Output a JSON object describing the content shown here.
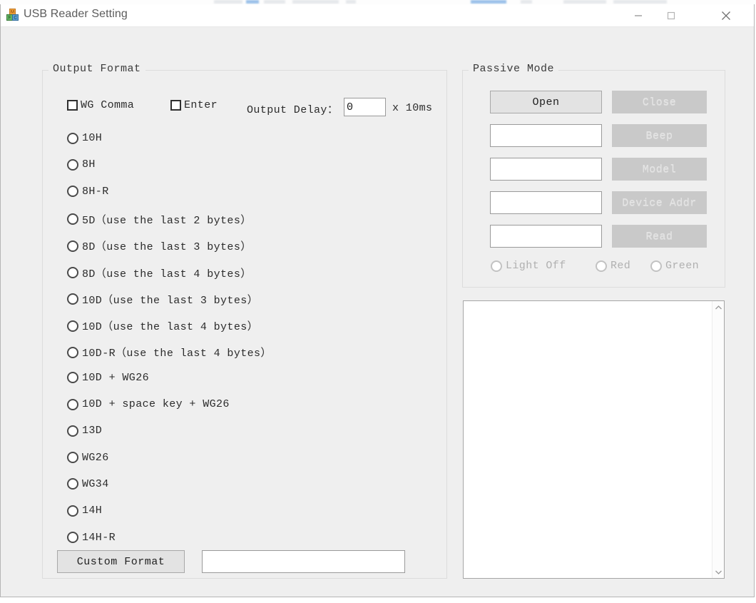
{
  "window": {
    "title": "USB Reader Setting",
    "icon": "toy-blocks-icon",
    "controls": {
      "minimize": "—",
      "maximize": "▢",
      "close": "✕"
    }
  },
  "output_format": {
    "legend": "Output Format",
    "checkboxes": [
      {
        "label": "WG Comma",
        "checked": false
      },
      {
        "label": "Enter",
        "checked": false
      }
    ],
    "delay": {
      "label": "Output Delay：",
      "value": "0",
      "placeholder": "",
      "unit": "x 10ms"
    },
    "radios": [
      {
        "label": "10H",
        "selected": false
      },
      {
        "label": "8H",
        "selected": false
      },
      {
        "label": "8H-R",
        "selected": false
      },
      {
        "label": "5D（use the last 2 bytes）",
        "selected": false
      },
      {
        "label": "8D（use the last 3 bytes）",
        "selected": false
      },
      {
        "label": "8D（use the last 4 bytes）",
        "selected": false
      },
      {
        "label": "10D（use the last 3 bytes）",
        "selected": false
      },
      {
        "label": "10D（use the last 4 bytes）",
        "selected": false
      },
      {
        "label": "10D-R（use the last 4 bytes）",
        "selected": false
      },
      {
        "label": "10D + WG26",
        "selected": false
      },
      {
        "label": "10D + space key + WG26",
        "selected": false
      },
      {
        "label": "13D",
        "selected": false
      },
      {
        "label": "WG26",
        "selected": false
      },
      {
        "label": "WG34",
        "selected": false
      },
      {
        "label": "14H",
        "selected": false
      },
      {
        "label": "14H-R",
        "selected": false
      }
    ],
    "custom": {
      "button_label": "Custom Format",
      "value": "",
      "placeholder": ""
    }
  },
  "passive_mode": {
    "legend": "Passive Mode",
    "buttons": [
      {
        "label": "Open",
        "enabled": true
      },
      {
        "label": "Close",
        "enabled": false
      },
      {
        "label": "Beep",
        "enabled": false
      },
      {
        "label": "Model",
        "enabled": false
      },
      {
        "label": "Device Addr",
        "enabled": false
      },
      {
        "label": "Read",
        "enabled": false
      }
    ],
    "inputs": [
      {
        "value": "",
        "placeholder": ""
      },
      {
        "value": "",
        "placeholder": ""
      },
      {
        "value": "",
        "placeholder": ""
      },
      {
        "value": "",
        "placeholder": ""
      }
    ],
    "light_radios": [
      {
        "label": "Light Off",
        "selected": false,
        "enabled": false
      },
      {
        "label": "Red",
        "selected": false,
        "enabled": false
      },
      {
        "label": "Green",
        "selected": false,
        "enabled": false
      }
    ]
  },
  "log_panel": {
    "content": "",
    "scrollbar": {
      "up": "⌃",
      "down": "⌄"
    }
  },
  "colors": {
    "window_bg": "#efefef",
    "titlebar_bg": "#ffffff",
    "button_bg": "#e3e3e3",
    "button_disabled_bg": "#c9c9c9",
    "field_bg": "#ffffff",
    "text": "#2b2b2b"
  }
}
